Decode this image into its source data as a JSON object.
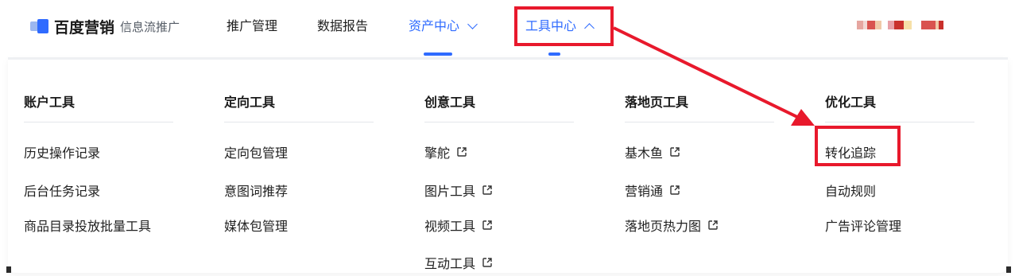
{
  "header": {
    "brand": "百度营销",
    "product": "信息流推广",
    "nav": [
      {
        "label": "推广管理"
      },
      {
        "label": "数据报告"
      },
      {
        "label": "资产中心"
      },
      {
        "label": "工具中心"
      }
    ]
  },
  "menu": {
    "columns": [
      {
        "title": "账户工具",
        "items": [
          {
            "label": "历史操作记录",
            "external": false
          },
          {
            "label": "后台任务记录",
            "external": false
          },
          {
            "label": "商品目录投放批量工具",
            "external": false
          }
        ]
      },
      {
        "title": "定向工具",
        "items": [
          {
            "label": "定向包管理",
            "external": false
          },
          {
            "label": "意图词推荐",
            "external": false
          },
          {
            "label": "媒体包管理",
            "external": false
          }
        ]
      },
      {
        "title": "创意工具",
        "items": [
          {
            "label": "擎舵",
            "external": true
          },
          {
            "label": "图片工具",
            "external": true
          },
          {
            "label": "视频工具",
            "external": true
          },
          {
            "label": "互动工具",
            "external": true
          }
        ]
      },
      {
        "title": "落地页工具",
        "items": [
          {
            "label": "基木鱼",
            "external": true
          },
          {
            "label": "营销通",
            "external": true
          },
          {
            "label": "落地页热力图",
            "external": true
          }
        ]
      },
      {
        "title": "优化工具",
        "items": [
          {
            "label": "转化追踪",
            "external": false
          },
          {
            "label": "自动规则",
            "external": false
          },
          {
            "label": "广告评论管理",
            "external": false
          }
        ]
      }
    ]
  },
  "colors": {
    "accent": "#2f6bff",
    "annotation": "#e8192c"
  },
  "icons": {
    "external": "external-link-icon",
    "chevron_down": "chevron-down-icon",
    "chevron_up": "chevron-up-icon"
  }
}
